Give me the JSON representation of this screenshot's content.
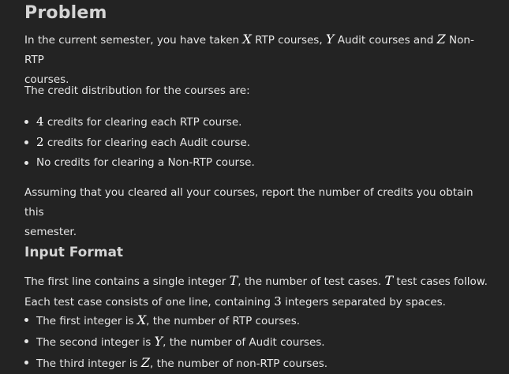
{
  "problem": {
    "heading": "Problem",
    "intro": {
      "t1": "In the current semester, you have taken ",
      "v1": "X",
      "t2": " RTP courses, ",
      "v2": "Y",
      "t3": " Audit courses and ",
      "v3": "Z",
      "t4": " Non-RTP",
      "line2": "courses."
    },
    "distribution_text": "The credit distribution for the courses are:",
    "credits": [
      {
        "num": "4",
        "text": " credits for clearing each RTP course."
      },
      {
        "num": "2",
        "text": " credits for clearing each Audit course."
      },
      {
        "num": "",
        "text": "No credits for clearing a Non-RTP course."
      }
    ],
    "assume_line1": "Assuming that you cleared all your courses, report the number of credits you obtain this",
    "assume_line2": "semester."
  },
  "input_format": {
    "heading": "Input Format",
    "line1": {
      "t1": "The first line contains a single integer ",
      "v1": "T",
      "t2": ", the number of test cases. ",
      "v2": "T",
      "t3": " test cases follow."
    },
    "line2": {
      "t1": "Each test case consists of one line, containing ",
      "n1": "3",
      "t2": " integers separated by spaces."
    },
    "items": [
      {
        "t1": "The first integer is ",
        "v": "X",
        "t2": ", the number of RTP courses."
      },
      {
        "t1": "The second integer is ",
        "v": "Y",
        "t2": ", the number of Audit courses."
      },
      {
        "t1": "The third integer is ",
        "v": "Z",
        "t2": ", the number of non-RTP courses."
      }
    ]
  }
}
